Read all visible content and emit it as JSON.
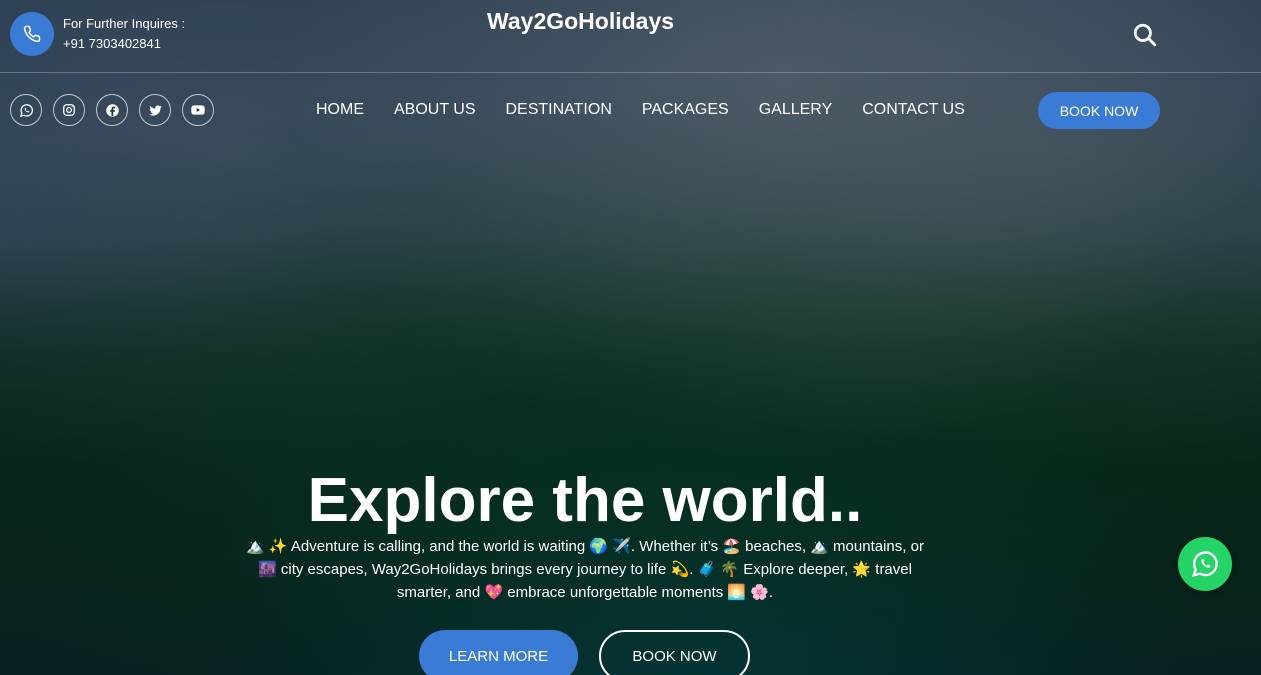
{
  "header": {
    "inquiry_label": "For Further Inquires :",
    "phone": "+91 7303402841",
    "brand": "Way2GoHolidays"
  },
  "socials": [
    {
      "icon": "whatsapp-icon"
    },
    {
      "icon": "instagram-icon"
    },
    {
      "icon": "facebook-icon"
    },
    {
      "icon": "twitter-icon"
    },
    {
      "icon": "youtube-icon"
    }
  ],
  "nav": {
    "items": [
      "HOME",
      "ABOUT US",
      "DESTINATION",
      "PACKAGES",
      "GALLERY",
      "CONTACT US"
    ],
    "book_now": "BOOK NOW"
  },
  "hero": {
    "title": "Explore the world..",
    "text": "🏔️ ✨ Adventure is calling, and the world is waiting 🌍 ✈️. Whether it’s 🏖️ beaches, 🏔️ mountains, or 🌆 city escapes, Way2GoHolidays brings every journey to life 💫. 🧳 🌴 Explore deeper, 🌟 travel smarter, and 💖 embrace unforgettable moments 🌅 🌸.",
    "learn_more": "LEARN MORE",
    "book_now": "BOOK NOW"
  },
  "colors": {
    "accent": "#3a7bd5",
    "whatsapp": "#25d366"
  }
}
